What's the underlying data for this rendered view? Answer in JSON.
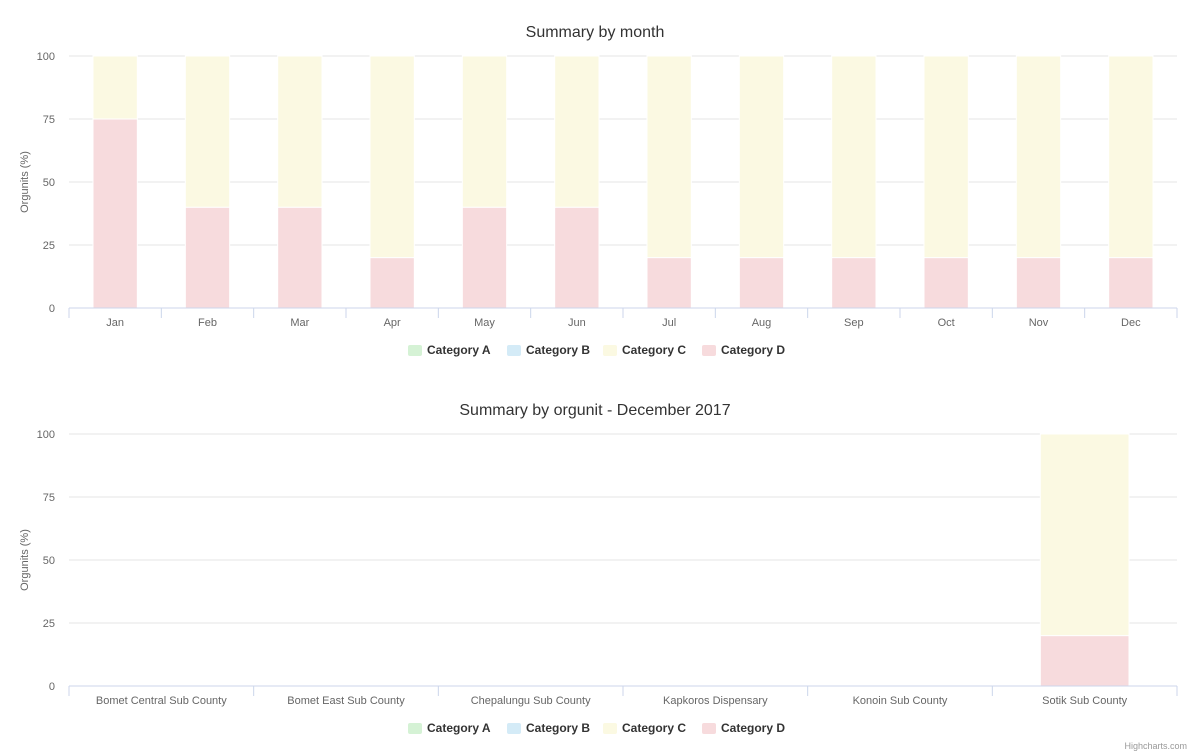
{
  "legend_items": [
    "Category A",
    "Category B",
    "Category C",
    "Category D"
  ],
  "series_colors": {
    "Category A": "#d5f2d5",
    "Category B": "#d4ebf7",
    "Category C": "#fbf9e2",
    "Category D": "#f7dbdd"
  },
  "credits": "Highcharts.com",
  "chart_data": [
    {
      "type": "bar",
      "stacking": "percent",
      "title": "Summary by month",
      "ylabel": "Orgunits (%)",
      "ylim": [
        0,
        100
      ],
      "yticks": [
        0,
        25,
        50,
        75,
        100
      ],
      "categories": [
        "Jan",
        "Feb",
        "Mar",
        "Apr",
        "May",
        "Jun",
        "Jul",
        "Aug",
        "Sep",
        "Oct",
        "Nov",
        "Dec"
      ],
      "series": [
        {
          "name": "Category A",
          "values": [
            0,
            0,
            0,
            0,
            0,
            0,
            0,
            0,
            0,
            0,
            0,
            0
          ]
        },
        {
          "name": "Category B",
          "values": [
            0,
            0,
            0,
            0,
            0,
            0,
            0,
            0,
            0,
            0,
            0,
            0
          ]
        },
        {
          "name": "Category C",
          "values": [
            25,
            60,
            60,
            80,
            60,
            60,
            80,
            80,
            80,
            80,
            80,
            80
          ]
        },
        {
          "name": "Category D",
          "values": [
            75,
            40,
            40,
            20,
            40,
            40,
            20,
            20,
            20,
            20,
            20,
            20
          ]
        }
      ],
      "legend": "bottom-center",
      "grid": true
    },
    {
      "type": "bar",
      "stacking": "percent",
      "title": "Summary by orgunit - December 2017",
      "ylabel": "Orgunits (%)",
      "ylim": [
        0,
        100
      ],
      "yticks": [
        0,
        25,
        50,
        75,
        100
      ],
      "categories": [
        "Bomet Central Sub County",
        "Bomet East Sub County",
        "Chepalungu Sub County",
        "Kapkoros Dispensary",
        "Konoin Sub County",
        "Sotik Sub County"
      ],
      "series": [
        {
          "name": "Category A",
          "values": [
            0,
            0,
            0,
            0,
            0,
            0
          ]
        },
        {
          "name": "Category B",
          "values": [
            0,
            0,
            0,
            0,
            0,
            0
          ]
        },
        {
          "name": "Category C",
          "values": [
            0,
            0,
            0,
            0,
            0,
            80
          ]
        },
        {
          "name": "Category D",
          "values": [
            0,
            0,
            0,
            0,
            0,
            20
          ]
        }
      ],
      "legend": "bottom-center",
      "grid": true
    }
  ]
}
